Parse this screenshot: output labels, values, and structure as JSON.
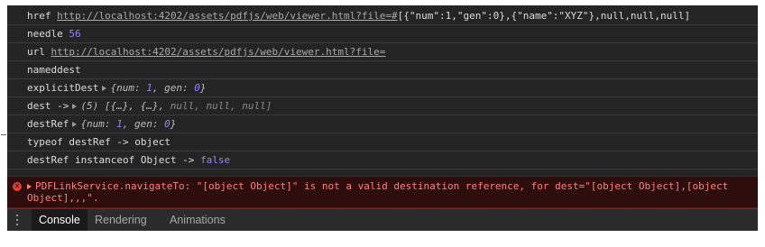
{
  "logs": {
    "href": {
      "label": "href",
      "url": "http://localhost:4202/assets/pdfjs/web/viewer.html?file=#",
      "json": "[{\"num\":1,\"gen\":0},{\"name\":\"XYZ\"},null,null,null]"
    },
    "needle": {
      "label": "needle",
      "value": "56"
    },
    "url": {
      "label": "url",
      "value": "http://localhost:4202/assets/pdfjs/web/viewer.html?file="
    },
    "nameddest": {
      "label": "nameddest"
    },
    "explicitDest": {
      "label": "explicitDest",
      "open": "{",
      "num_key": "num:",
      "num_val": "1",
      "gen_key": "gen:",
      "gen_val": "0",
      "close": "}"
    },
    "dest": {
      "label": "dest ->",
      "count": "(5)",
      "items": "[{…}, {…},",
      "null1": "null,",
      "null2": "null,",
      "null3": "null]"
    },
    "destRef": {
      "label": "destRef",
      "open": "{",
      "num_key": "num:",
      "num_val": "1",
      "gen_key": "gen:",
      "gen_val": "0",
      "close": "}"
    },
    "typeof": {
      "text": "typeof destRef -> object"
    },
    "instanceof": {
      "text": "destRef instanceof Object ->",
      "value": "false"
    }
  },
  "error": {
    "icon": "error-x-icon",
    "glyph": "✕",
    "message": "PDFLinkService.navigateTo: \"[object Object]\" is not a valid destination reference, for dest=\"[object Object],[object Object],,,\"."
  },
  "tabs": [
    {
      "label": "Console",
      "active": true
    },
    {
      "label": "Rendering",
      "active": false
    },
    {
      "label": "Animations",
      "active": false
    }
  ],
  "colors": {
    "background": "#242424",
    "error_bg": "#2e0d0d",
    "error_text": "#ff8080",
    "number": "#9980ff"
  }
}
